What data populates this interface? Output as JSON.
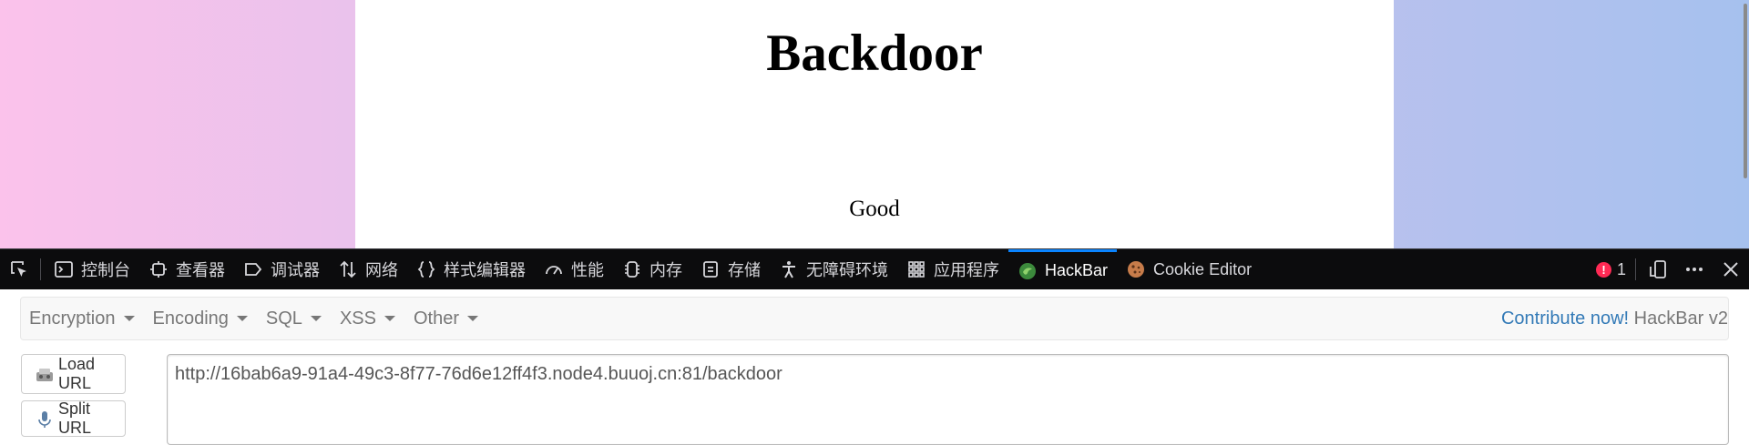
{
  "page": {
    "title": "Backdoor",
    "message": "Good"
  },
  "devtools": {
    "tabs": [
      {
        "label": "控制台",
        "icon": "console-icon"
      },
      {
        "label": "查看器",
        "icon": "inspector-icon"
      },
      {
        "label": "调试器",
        "icon": "debugger-icon"
      },
      {
        "label": "网络",
        "icon": "network-icon"
      },
      {
        "label": "样式编辑器",
        "icon": "style-editor-icon"
      },
      {
        "label": "性能",
        "icon": "performance-icon"
      },
      {
        "label": "内存",
        "icon": "memory-icon"
      },
      {
        "label": "存储",
        "icon": "storage-icon"
      },
      {
        "label": "无障碍环境",
        "icon": "accessibility-icon"
      },
      {
        "label": "应用程序",
        "icon": "application-icon"
      },
      {
        "label": "HackBar",
        "icon": "hackbar-icon",
        "active": true
      },
      {
        "label": "Cookie Editor",
        "icon": "cookie-icon"
      }
    ],
    "error_count": "1",
    "accent_color": "#0a84ff"
  },
  "hackbar": {
    "menus": [
      "Encryption",
      "Encoding",
      "SQL",
      "XSS",
      "Other"
    ],
    "contribute_label": "Contribute now!",
    "version_label": "HackBar v2",
    "load_url_label": "Load URL",
    "split_url_label": "Split URL",
    "url_value": "http://16bab6a9-91a4-49c3-8f77-76d6e12ff4f3.node4.buuoj.cn:81/backdoor"
  }
}
